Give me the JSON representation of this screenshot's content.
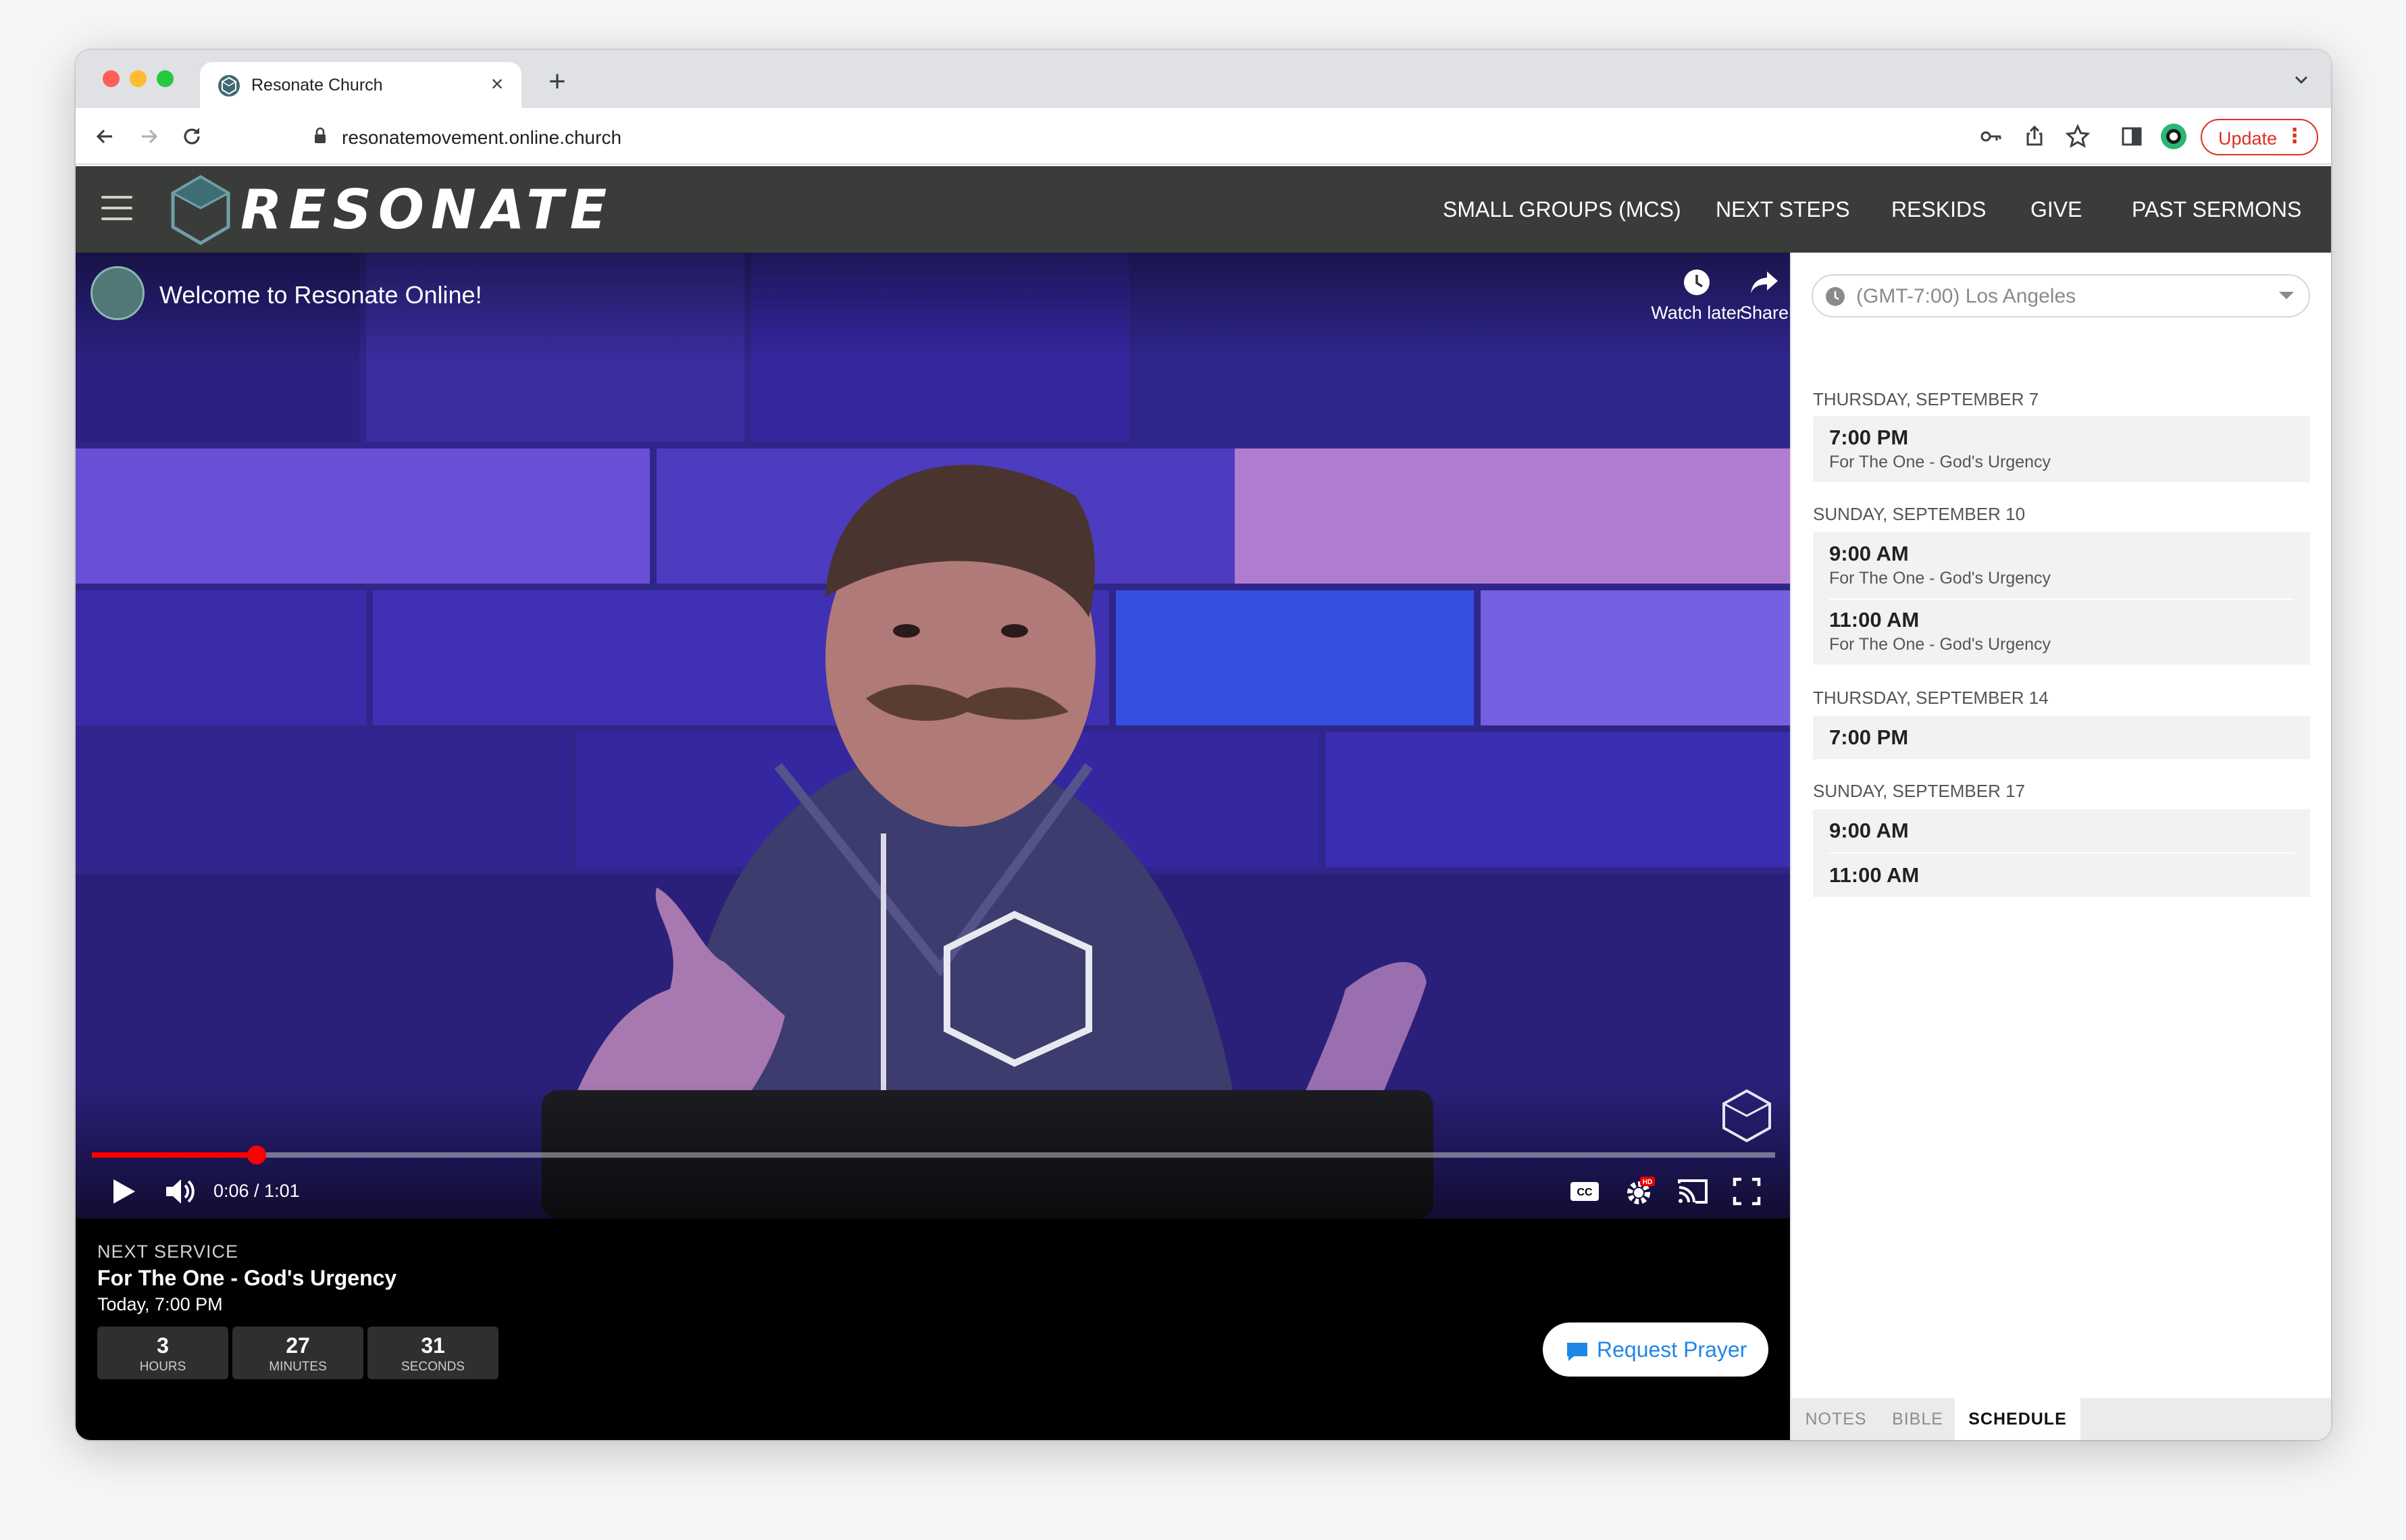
{
  "browser": {
    "tab_title": "Resonate Church",
    "close_glyph": "×",
    "new_tab_glyph": "+",
    "url": "resonatemovement.online.church",
    "update_label": "Update",
    "update_menu_glyph": "⋮"
  },
  "site": {
    "logo_text": "RESONATE",
    "nav": [
      "SMALL GROUPS (MCS)",
      "NEXT STEPS",
      "RESKIDS",
      "GIVE",
      "PAST SERMONS"
    ]
  },
  "video": {
    "title": "Welcome to Resonate Online!",
    "watch_later_label": "Watch later",
    "share_label": "Share",
    "time_text": "0:06 / 1:01",
    "progress": 0.098,
    "cc_label": "CC",
    "hd_badge": "HD"
  },
  "next_service": {
    "label": "NEXT SERVICE",
    "title": "For The One - God's Urgency",
    "time": "Today, 7:00 PM",
    "countdown": [
      {
        "value": "3",
        "unit": "HOURS"
      },
      {
        "value": "27",
        "unit": "MINUTES"
      },
      {
        "value": "31",
        "unit": "SECONDS"
      }
    ],
    "prayer_button": "Request Prayer"
  },
  "schedule": {
    "timezone": "(GMT-7:00) Los Angeles",
    "days": [
      {
        "label": "THURSDAY, SEPTEMBER 7",
        "slots": [
          {
            "time": "7:00 PM",
            "title": "For The One - God's Urgency"
          }
        ]
      },
      {
        "label": "SUNDAY, SEPTEMBER 10",
        "slots": [
          {
            "time": "9:00 AM",
            "title": "For The One - God's Urgency"
          },
          {
            "time": "11:00 AM",
            "title": "For The One - God's Urgency"
          }
        ]
      },
      {
        "label": "THURSDAY, SEPTEMBER 14",
        "slots": [
          {
            "time": "7:00 PM",
            "title": ""
          }
        ]
      },
      {
        "label": "SUNDAY, SEPTEMBER 17",
        "slots": [
          {
            "time": "9:00 AM",
            "title": ""
          },
          {
            "time": "11:00 AM",
            "title": ""
          }
        ]
      }
    ],
    "tabs": [
      "NOTES",
      "BIBLE",
      "SCHEDULE"
    ],
    "active_tab": "SCHEDULE"
  },
  "colors": {
    "header_bg": "#393c38",
    "accent_red": "#ff0000",
    "prayer_blue": "#1f87e5",
    "update_red": "#d93025"
  }
}
